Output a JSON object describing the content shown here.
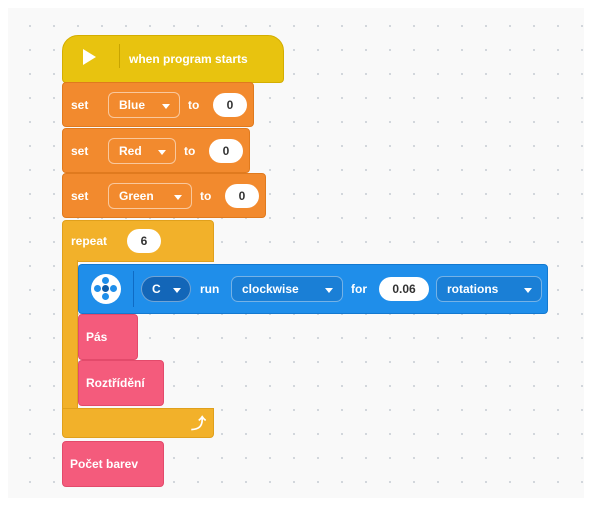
{
  "event_block": {
    "label": "when program starts",
    "icon": "play-icon"
  },
  "set_blocks": [
    {
      "set_label": "set",
      "variable": "Blue",
      "to_label": "to",
      "value": "0"
    },
    {
      "set_label": "set",
      "variable": "Red",
      "to_label": "to",
      "value": "0"
    },
    {
      "set_label": "set",
      "variable": "Green",
      "to_label": "to",
      "value": "0"
    }
  ],
  "repeat_block": {
    "label": "repeat",
    "count": "6",
    "loop_icon": "loop-arrow-icon"
  },
  "motor_block": {
    "port": "C",
    "run_label": "run",
    "direction": "clockwise",
    "for_label": "for",
    "amount": "0.06",
    "unit": "rotations",
    "icon": "motor-icon"
  },
  "custom_blocks": {
    "pas": "Pás",
    "roztrideni": "Roztřídění",
    "pocet_barev": "Počet barev"
  },
  "colors": {
    "event": "#e8c30f",
    "variables": "#f28a2e",
    "control": "#f2b12a",
    "motor": "#1f8eea",
    "my_blocks": "#f45b7c"
  }
}
